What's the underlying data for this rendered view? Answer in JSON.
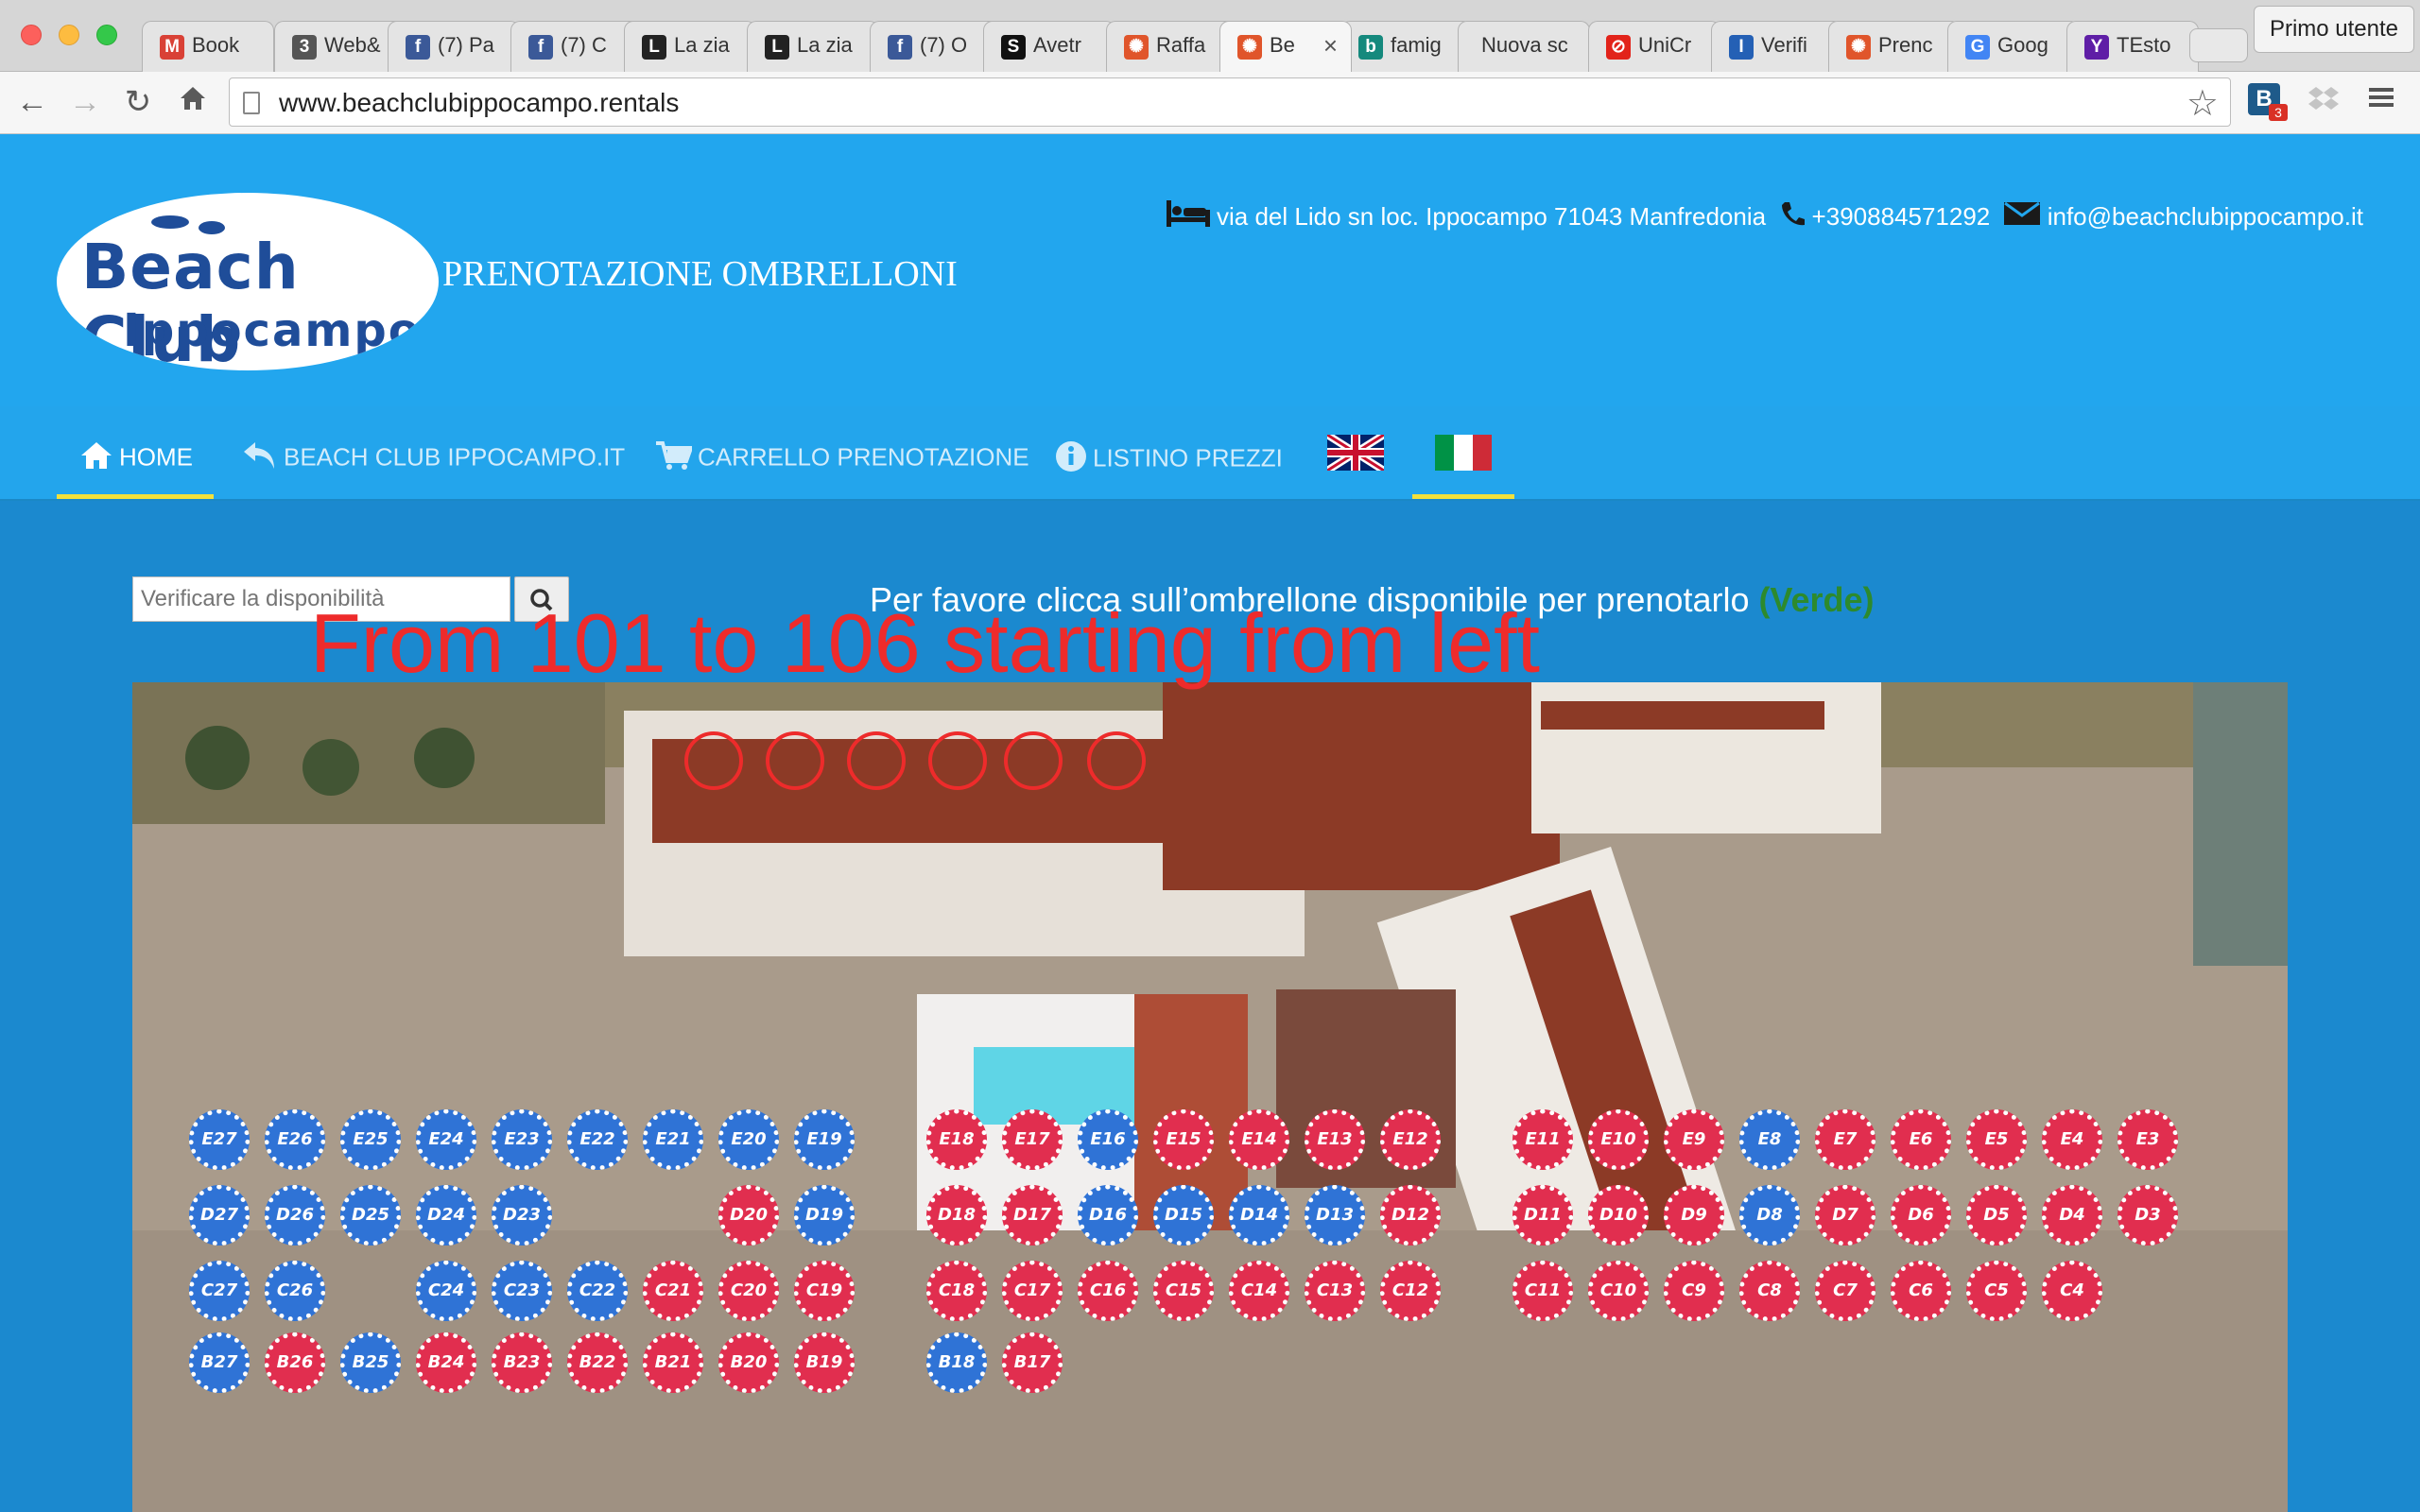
{
  "browser": {
    "tabs": [
      {
        "label": "Book",
        "icon": "gmail-icon",
        "color": "#d94136",
        "glyph": "M"
      },
      {
        "label": "Web&",
        "icon": "three-icon",
        "color": "#555555",
        "glyph": "3"
      },
      {
        "label": "(7) Pa",
        "icon": "facebook-icon",
        "color": "#3b5998",
        "glyph": "f"
      },
      {
        "label": "(7) C",
        "icon": "facebook-icon",
        "color": "#3b5998",
        "glyph": "f"
      },
      {
        "label": "La zia",
        "icon": "l-icon",
        "color": "#222222",
        "glyph": "L"
      },
      {
        "label": "La zia",
        "icon": "l-icon",
        "color": "#222222",
        "glyph": "L"
      },
      {
        "label": "(7) O",
        "icon": "facebook-icon",
        "color": "#3b5998",
        "glyph": "f"
      },
      {
        "label": "Avetr",
        "icon": "s-icon",
        "color": "#111111",
        "glyph": "S"
      },
      {
        "label": "Raffa",
        "icon": "beach-icon",
        "color": "#e0552b",
        "glyph": "✺"
      },
      {
        "label": "Be",
        "icon": "beach-icon",
        "color": "#e0552b",
        "glyph": "✺",
        "active": true
      },
      {
        "label": "famig",
        "icon": "bing-icon",
        "color": "#15897d",
        "glyph": "b"
      },
      {
        "label": "Nuova sc",
        "icon": "",
        "color": "",
        "glyph": ""
      },
      {
        "label": "UniCr",
        "icon": "unicredit-icon",
        "color": "#e2231a",
        "glyph": "⊘"
      },
      {
        "label": "Verifi",
        "icon": "iban-icon",
        "color": "#2460b5",
        "glyph": "I"
      },
      {
        "label": "Prenc",
        "icon": "beach-icon",
        "color": "#e0552b",
        "glyph": "✺"
      },
      {
        "label": "Goog",
        "icon": "google-translate-icon",
        "color": "#4285f4",
        "glyph": "G"
      },
      {
        "label": "TEsto",
        "icon": "yahoo-icon",
        "color": "#5f1ea6",
        "glyph": "Y"
      }
    ],
    "profile": "Primo utente",
    "url": "www.beachclubippocampo.rentals",
    "extension_badge": "3",
    "extension_letter": "B"
  },
  "header": {
    "logo_line1": "Beach Club",
    "logo_line2": "Ippocampo",
    "title": "PRENOTAZIONE OMBRELLONI",
    "address": "via del Lido sn loc. Ippocampo 71043 Manfredonia",
    "phone": "+390884571292",
    "email": "info@beachclubippocampo.it"
  },
  "nav": {
    "home": "HOME",
    "site": "BEACH CLUB IPPOCAMPO.IT",
    "cart": "CARRELLO PRENOTAZIONE",
    "prices": "LISTINO PREZZI"
  },
  "search": {
    "placeholder": "Verificare la disponibilità"
  },
  "instruction": {
    "text": "Per favore clicca sull’ombrellone disponibile per prenotarlo ",
    "highlight": "(Verde)"
  },
  "annotation": "From 101 to 106 starting from left",
  "map": {
    "colors": {
      "booked": "#e12e4f",
      "available": "#2f73d6",
      "sand": "#a79988"
    },
    "rows": [
      {
        "row": "E",
        "free": [
          "E27",
          "E26",
          "E25",
          "E24",
          "E23",
          "E22",
          "E21",
          "E20",
          "E19",
          "E16",
          "E8"
        ],
        "booked": [
          "E18",
          "E17",
          "E15",
          "E14",
          "E13",
          "E12",
          "E11",
          "E10",
          "E9",
          "E7",
          "E6",
          "E5",
          "E4",
          "E3"
        ]
      },
      {
        "row": "D",
        "free": [
          "D27",
          "D26",
          "D25",
          "D24",
          "D23",
          "D19",
          "D16",
          "D15",
          "D14",
          "D13",
          "D8"
        ],
        "booked": [
          "D20",
          "D18",
          "D17",
          "D12",
          "D11",
          "D10",
          "D9",
          "D7",
          "D6",
          "D5",
          "D4",
          "D3"
        ]
      },
      {
        "row": "C",
        "free": [
          "C27",
          "C26",
          "C24",
          "C23",
          "C22"
        ],
        "booked": [
          "C21",
          "C20",
          "C19",
          "C18",
          "C17",
          "C16",
          "C15",
          "C14",
          "C13",
          "C12",
          "C11",
          "C10",
          "C9",
          "C8",
          "C7",
          "C6",
          "C5",
          "C4"
        ]
      },
      {
        "row": "B",
        "free": [
          "B27",
          "B25",
          "B18"
        ],
        "booked": [
          "B26",
          "B24",
          "B23",
          "B22",
          "B21",
          "B20",
          "B19",
          "B17"
        ]
      }
    ]
  }
}
